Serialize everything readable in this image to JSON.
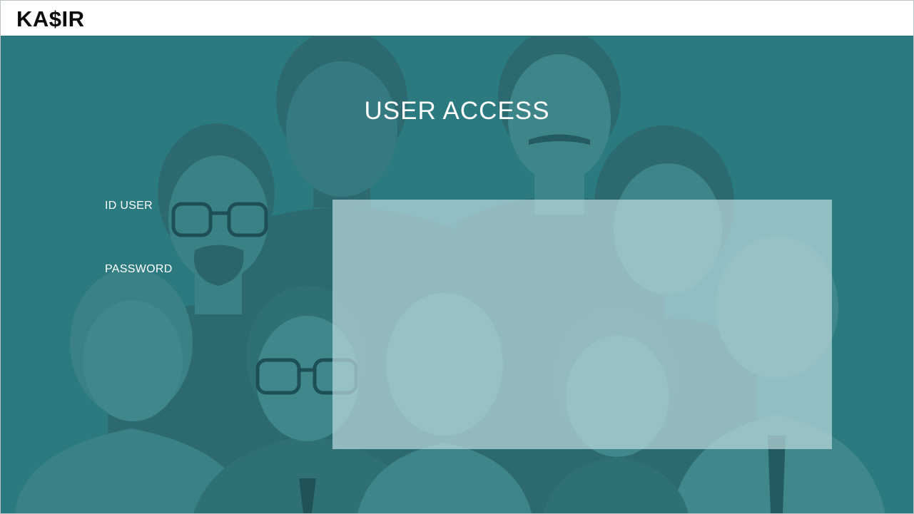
{
  "app": {
    "logo_text": "KA$IR"
  },
  "login": {
    "title": "USER ACCESS",
    "id_label": "ID USER",
    "password_label": "PASSWORD",
    "id_value": "",
    "password_value": ""
  },
  "colors": {
    "background_teal": "#2a7a7f",
    "figure_dark": "#2d6a70",
    "figure_light": "#3f878b",
    "panel": "#bedcde",
    "text_light": "#ffffff",
    "logo_text": "#0a0a0a"
  },
  "icons": {
    "background_illustration": "group-of-people-illustration"
  }
}
